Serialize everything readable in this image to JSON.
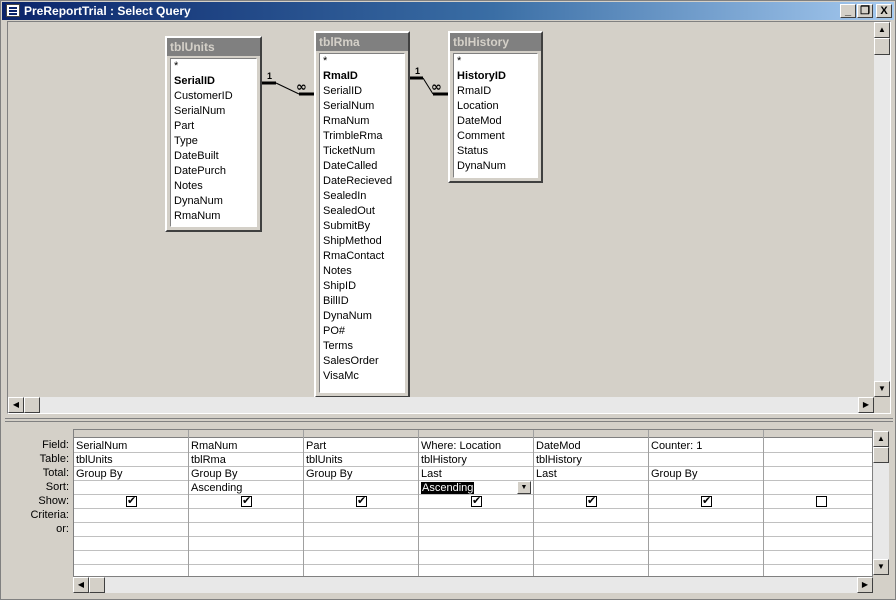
{
  "window": {
    "title": "PreReportTrial : Select Query"
  },
  "caption_buttons": {
    "minimize": "_",
    "restore": "❐",
    "close": "X"
  },
  "tables": [
    {
      "name": "tblUnits",
      "fields": [
        "*",
        "SerialID",
        "CustomerID",
        "SerialNum",
        "Part",
        "Type",
        "DateBuilt",
        "DatePurch",
        "Notes",
        "DynaNum",
        "RmaNum"
      ],
      "primary_key": "SerialID"
    },
    {
      "name": "tblRma",
      "fields": [
        "*",
        "RmaID",
        "SerialID",
        "SerialNum",
        "RmaNum",
        "TrimbleRma",
        "TicketNum",
        "DateCalled",
        "DateRecieved",
        "SealedIn",
        "SealedOut",
        "SubmitBy",
        "ShipMethod",
        "RmaContact",
        "Notes",
        "ShipID",
        "BillID",
        "DynaNum",
        "PO#",
        "Terms",
        "SalesOrder",
        "VisaMc"
      ],
      "primary_key": "RmaID"
    },
    {
      "name": "tblHistory",
      "fields": [
        "*",
        "HistoryID",
        "RmaID",
        "Location",
        "DateMod",
        "Comment",
        "Status",
        "DynaNum"
      ],
      "primary_key": "HistoryID"
    }
  ],
  "joins": [
    {
      "one_label": "1",
      "many_label": "∞"
    },
    {
      "one_label": "1",
      "many_label": "∞"
    }
  ],
  "grid": {
    "row_labels": [
      "Field:",
      "Table:",
      "Total:",
      "Sort:",
      "Show:",
      "Criteria:",
      "or:"
    ],
    "columns": [
      {
        "field": "SerialNum",
        "table": "tblUnits",
        "total": "Group By",
        "sort": "",
        "show": true
      },
      {
        "field": "RmaNum",
        "table": "tblRma",
        "total": "Group By",
        "sort": "Ascending",
        "show": true
      },
      {
        "field": "Part",
        "table": "tblUnits",
        "total": "Group By",
        "sort": "",
        "show": true
      },
      {
        "field": "Where: Location",
        "table": "tblHistory",
        "total": "Last",
        "sort": "Ascending",
        "show": true,
        "sort_selected": true
      },
      {
        "field": "DateMod",
        "table": "tblHistory",
        "total": "Last",
        "sort": "",
        "show": true
      },
      {
        "field": "Counter: 1",
        "table": "",
        "total": "Group By",
        "sort": "",
        "show": true
      },
      {
        "field": "",
        "table": "",
        "total": "",
        "sort": "",
        "show": false
      }
    ]
  },
  "icons": {
    "app": "query-window-icon",
    "scroll_up": "▲",
    "scroll_down": "▼",
    "scroll_left": "◀",
    "scroll_right": "▶",
    "dropdown": "▼"
  }
}
